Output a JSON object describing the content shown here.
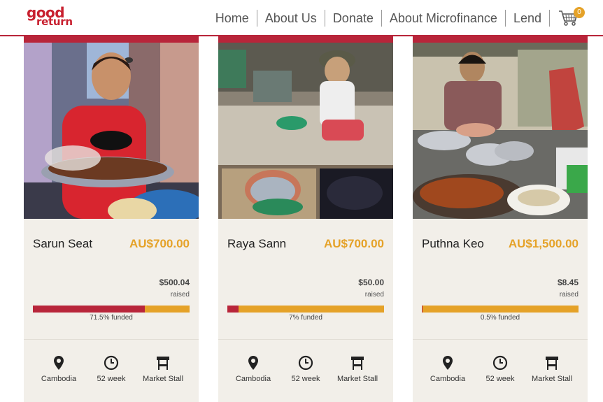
{
  "brand": {
    "logo_good": "good",
    "logo_return": "return",
    "color": "#c8202f"
  },
  "nav": {
    "items": [
      "Home",
      "About Us",
      "Donate",
      "About Microfinance",
      "Lend"
    ],
    "cart_count": "0"
  },
  "colors": {
    "accent_red": "#b8253a",
    "accent_orange": "#e5a228",
    "card_bg": "#f2efe9"
  },
  "raised_label": "raised",
  "cards": [
    {
      "name": "Sarun Seat",
      "amount": "AU$700.00",
      "raised": "$500.04",
      "funded_text": "71.5% funded",
      "funded_fraction": 0.715,
      "meta": {
        "location": "Cambodia",
        "term": "52 week",
        "sector": "Market Stall"
      },
      "icons": {
        "location": "location-pin-icon",
        "term": "clock-icon",
        "sector": "market-stall-icon"
      }
    },
    {
      "name": "Raya Sann",
      "amount": "AU$700.00",
      "raised": "$50.00",
      "funded_text": "7% funded",
      "funded_fraction": 0.07,
      "meta": {
        "location": "Cambodia",
        "term": "52 week",
        "sector": "Market Stall"
      },
      "icons": {
        "location": "location-pin-icon",
        "term": "clock-icon",
        "sector": "market-stall-icon"
      }
    },
    {
      "name": "Puthna Keo",
      "amount": "AU$1,500.00",
      "raised": "$8.45",
      "funded_text": "0.5% funded",
      "funded_fraction": 0.005,
      "meta": {
        "location": "Cambodia",
        "term": "52 week",
        "sector": "Market Stall"
      },
      "icons": {
        "location": "location-pin-icon",
        "term": "clock-icon",
        "sector": "market-stall-icon"
      }
    }
  ]
}
